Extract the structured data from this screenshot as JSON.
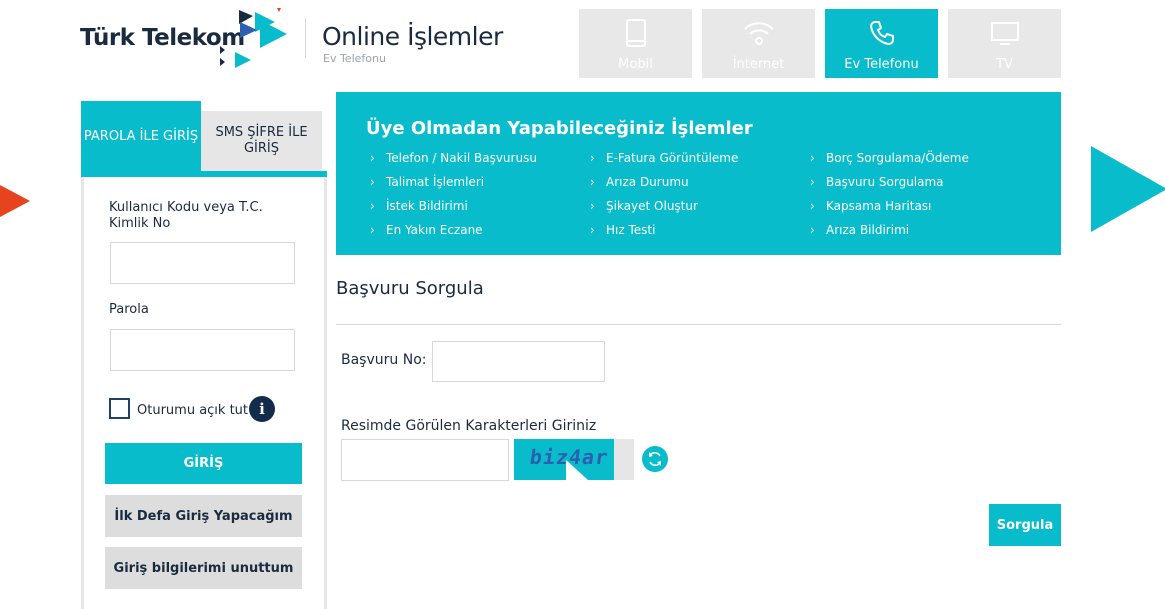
{
  "header": {
    "logo_text": "Türk Telekom",
    "app_title": "Online İşlemler",
    "app_subtitle": "Ev Telefonu",
    "service_tabs": [
      {
        "label": "Mobil",
        "icon": "mobile-phone-icon",
        "active": false
      },
      {
        "label": "İnternet",
        "icon": "wifi-icon",
        "active": false
      },
      {
        "label": "Ev Telefonu",
        "icon": "phone-handset-icon",
        "active": true
      },
      {
        "label": "TV",
        "icon": "tv-icon",
        "active": false
      }
    ]
  },
  "login": {
    "tabs": [
      {
        "label": "PAROLA İLE GİRİŞ",
        "active": true
      },
      {
        "label": "SMS ŞİFRE İLE GİRİŞ",
        "active": false
      }
    ],
    "username_label": "Kullanıcı Kodu veya T.C. Kimlik No",
    "username_value": "",
    "password_label": "Parola",
    "password_value": "",
    "remember_label": "Oturumu açık tut",
    "remember_checked": false,
    "info_icon": "i",
    "login_button": "GİRİŞ",
    "first_login_button": "İlk Defa Giriş Yapacağım",
    "forgot_button": "Giriş bilgilerimi unuttum"
  },
  "operations": {
    "title": "Üye Olmadan Yapabileceğiniz İşlemler",
    "columns": [
      [
        "Telefon / Nakil Başvurusu",
        "Talimat İşlemleri",
        "İstek Bildirimi",
        "En Yakın Eczane"
      ],
      [
        "E-Fatura Görüntüleme",
        "Arıza Durumu",
        "Şikayet Oluştur",
        "Hız Testi"
      ],
      [
        "Borç Sorgulama/Ödeme",
        "Başvuru Sorgulama",
        "Kapsama Haritası",
        "Arıza Bildirimi"
      ]
    ]
  },
  "form": {
    "title": "Başvuru Sorgula",
    "basvuru_label": "Başvuru No:",
    "basvuru_value": "",
    "captcha_label": "Resimde Görülen Karakterleri Giriniz",
    "captcha_value": "",
    "captcha_text": "biz4ar",
    "submit_label": "Sorgula"
  },
  "colors": {
    "accent": "#09bccb",
    "navy": "#1a2b40",
    "orange": "#e8431f",
    "tab_inactive": "#e8e8e8"
  }
}
